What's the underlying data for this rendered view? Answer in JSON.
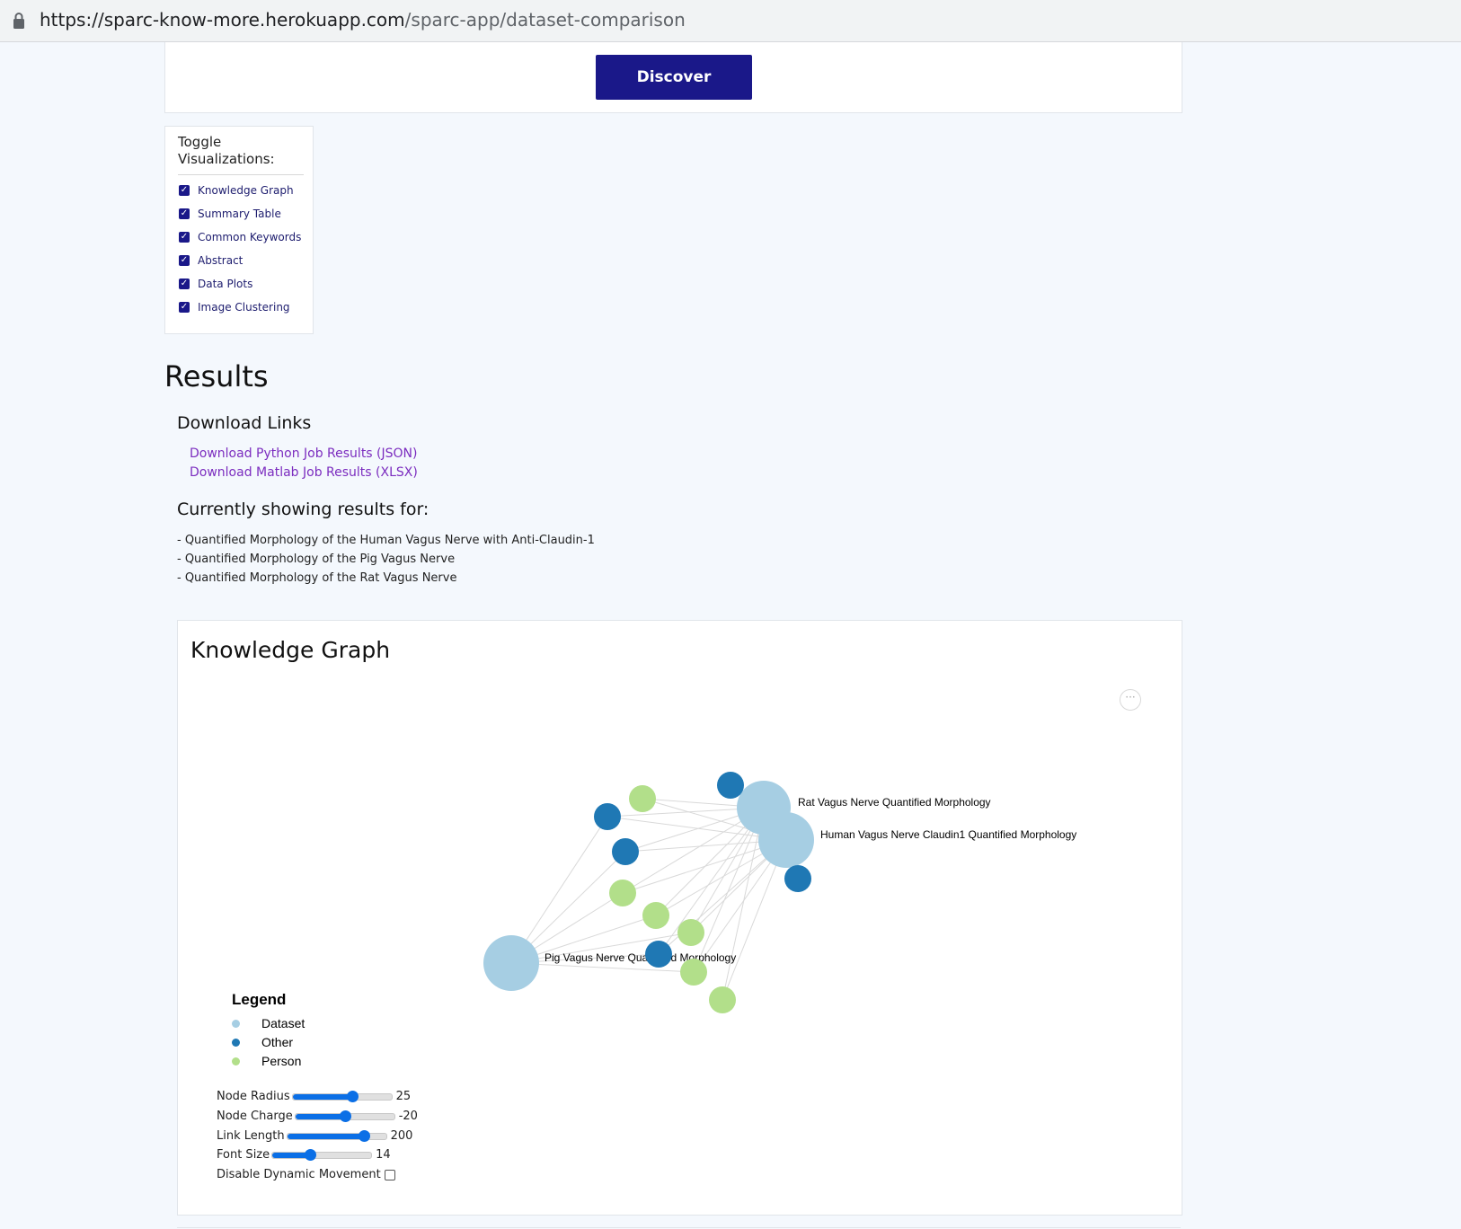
{
  "browser": {
    "url_host": "https://sparc-know-more.herokuapp.com",
    "url_path": "/sparc-app/dataset-comparison"
  },
  "discover": {
    "button_label": "Discover"
  },
  "toggle": {
    "title": "Toggle Visualizations:",
    "items": [
      {
        "label": "Knowledge Graph",
        "checked": true
      },
      {
        "label": "Summary Table",
        "checked": true
      },
      {
        "label": "Common Keywords",
        "checked": true
      },
      {
        "label": "Abstract",
        "checked": true
      },
      {
        "label": "Data Plots",
        "checked": true
      },
      {
        "label": "Image Clustering",
        "checked": true
      }
    ]
  },
  "results": {
    "heading": "Results",
    "download_heading": "Download Links",
    "links": [
      "Download Python Job Results (JSON)",
      "Download Matlab Job Results (XLSX)"
    ],
    "showing_heading": "Currently showing results for:",
    "datasets": [
      "- Quantified Morphology of the Human Vagus Nerve with Anti-Claudin-1",
      "- Quantified Morphology of the Pig Vagus Nerve",
      "- Quantified Morphology of the Rat Vagus Nerve"
    ]
  },
  "knowledge_graph": {
    "title": "Knowledge Graph",
    "more_icon": "more-horizontal-icon",
    "colors": {
      "Dataset": "#a6cee3",
      "Other": "#1f78b4",
      "Person": "#b2df8a",
      "link": "#d9d9d9"
    },
    "labels": [
      "Rat Vagus Nerve Quantified Morphology",
      "Human Vagus Nerve Claudin1 Quantified Morphology",
      "Pig Vagus Nerve Quantified Morphology"
    ],
    "legend": {
      "title": "Legend",
      "items": [
        "Dataset",
        "Other",
        "Person"
      ]
    },
    "controls": [
      {
        "label": "Node Radius",
        "value": "25",
        "fraction": 0.6
      },
      {
        "label": "Node Charge",
        "value": "-20",
        "fraction": 0.5
      },
      {
        "label": "Link Length",
        "value": "200",
        "fraction": 0.78
      },
      {
        "label": "Font Size",
        "value": "14",
        "fraction": 0.38
      }
    ],
    "disable_movement_label": "Disable Dynamic Movement"
  }
}
